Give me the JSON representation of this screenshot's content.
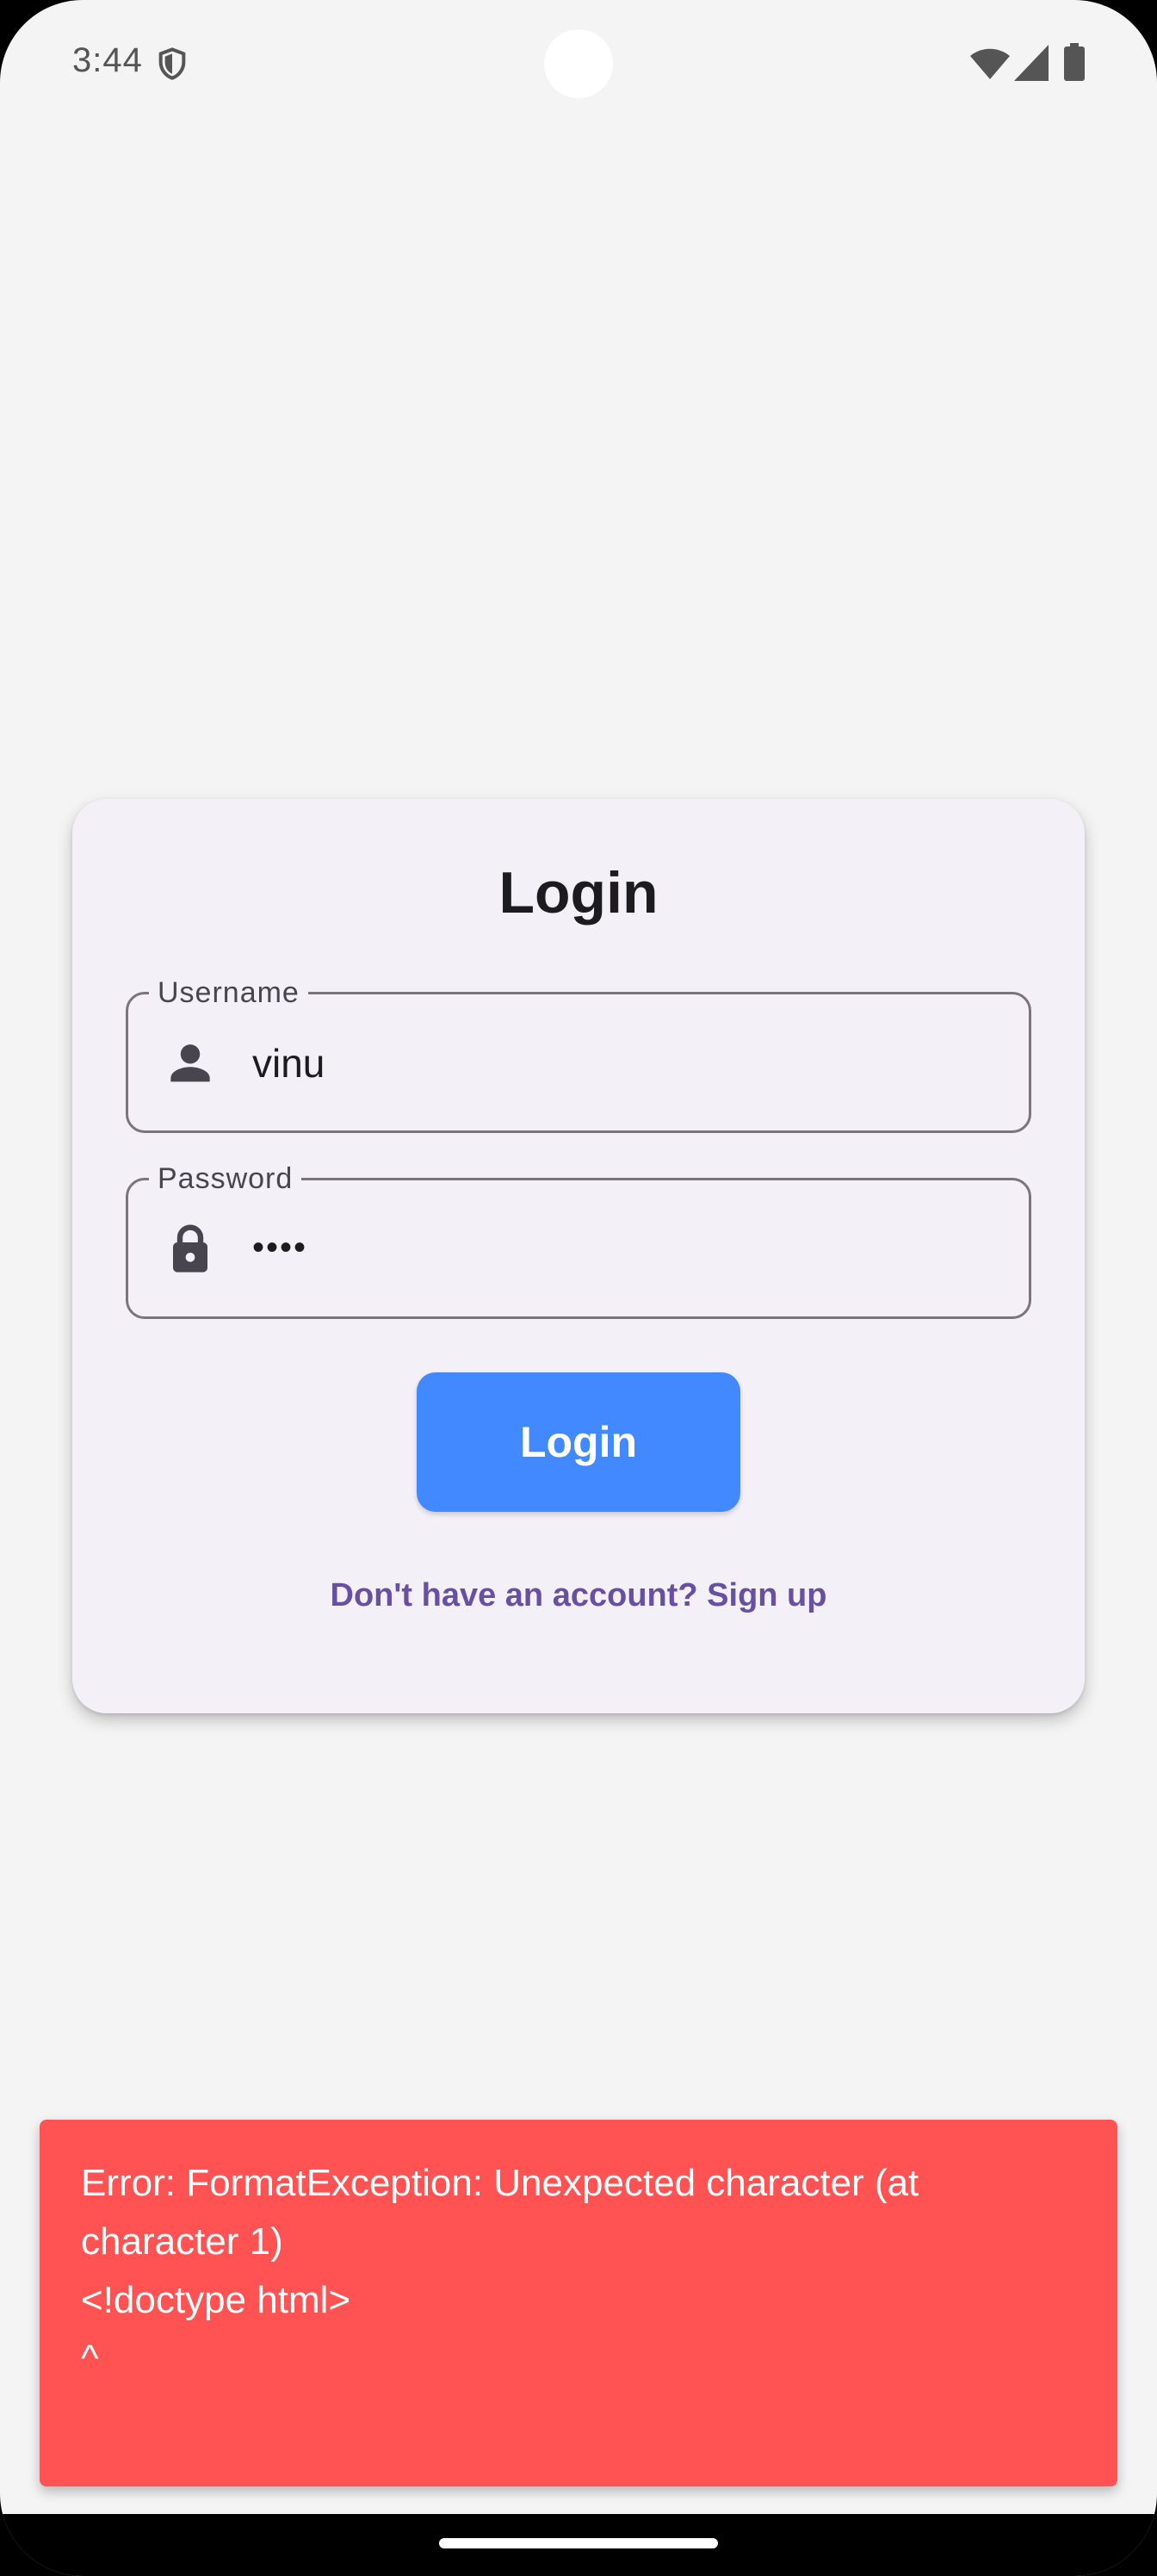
{
  "status_bar": {
    "time": "3:44",
    "icons": [
      "shield-icon",
      "wifi-icon",
      "signal-icon",
      "battery-icon"
    ]
  },
  "login_card": {
    "title": "Login",
    "username": {
      "label": "Username",
      "value": "vinu",
      "icon": "person-icon"
    },
    "password": {
      "label": "Password",
      "value": "••••",
      "icon": "lock-icon"
    },
    "login_button_label": "Login",
    "signup_link": "Don't have an account? Sign up"
  },
  "snackbar": {
    "message": "Error: FormatException: Unexpected character (at\ncharacter 1)\n<!doctype html>\n^"
  },
  "colors": {
    "background": "#f4f4f4",
    "card": "#f4f0f7",
    "primary_button": "#4289ff",
    "link": "#6750a4",
    "error": "#ff5252"
  }
}
